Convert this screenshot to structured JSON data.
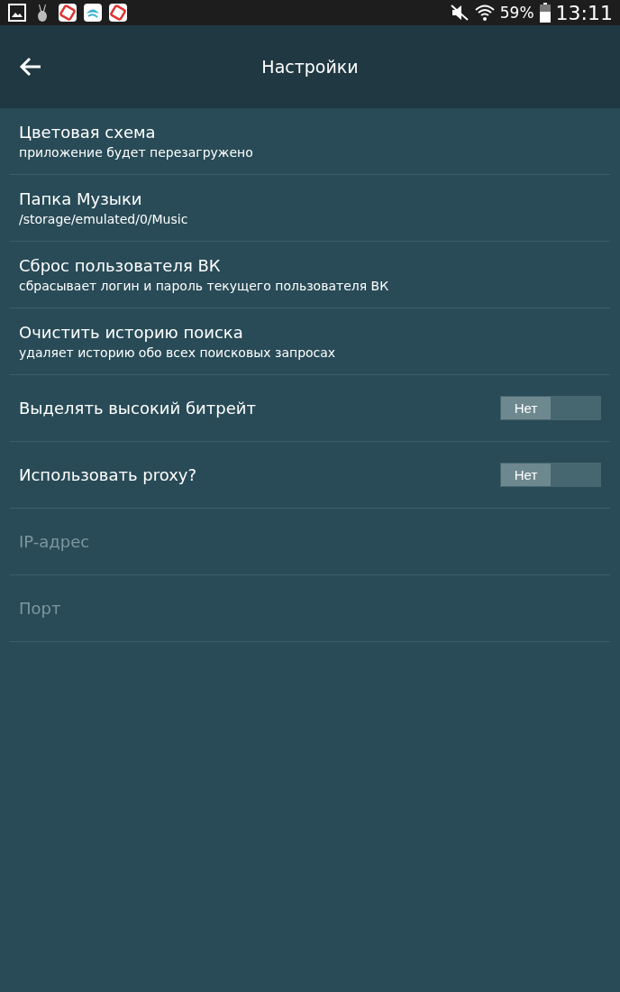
{
  "status_bar": {
    "battery": "59%",
    "time": "13:11"
  },
  "toolbar": {
    "title": "Настройки"
  },
  "settings": [
    {
      "kind": "text",
      "title": "Цветовая схема",
      "summary": "приложение будет перезагружено",
      "disabled": false
    },
    {
      "kind": "text",
      "title": "Папка Музыки",
      "summary": "/storage/emulated/0/Music",
      "disabled": false
    },
    {
      "kind": "text",
      "title": "Сброс пользователя ВК",
      "summary": "сбрасывает логин и пароль текущего пользователя ВК",
      "disabled": false
    },
    {
      "kind": "text",
      "title": "Очистить историю поиска",
      "summary": "удаляет историю обо всех поисковых запросах",
      "disabled": false
    },
    {
      "kind": "toggle",
      "title": "Выделять высокий битрейт",
      "switch_label": "Нет",
      "on": false,
      "disabled": false
    },
    {
      "kind": "toggle",
      "title": "Использовать proxy?",
      "switch_label": "Нет",
      "on": false,
      "disabled": false
    },
    {
      "kind": "text",
      "title": "IP-адрес",
      "disabled": true
    },
    {
      "kind": "text",
      "title": "Порт",
      "disabled": true
    }
  ]
}
